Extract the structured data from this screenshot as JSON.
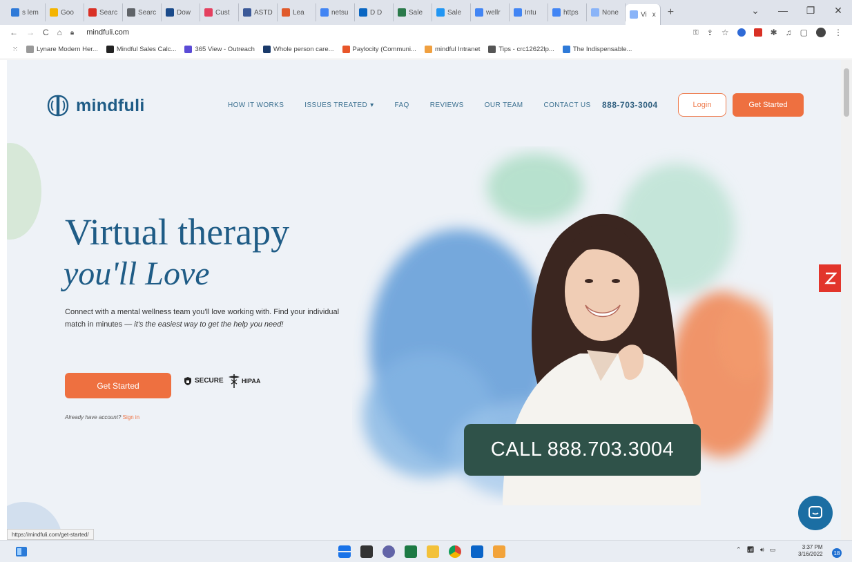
{
  "browser": {
    "tabs": [
      {
        "label": "s lem",
        "color": "#2f7ad8"
      },
      {
        "label": "Goo",
        "color": "#f4b400"
      },
      {
        "label": "Searc",
        "color": "#d93025"
      },
      {
        "label": "Searc",
        "color": "#5f6368"
      },
      {
        "label": "Dow",
        "color": "#1a4a8a"
      },
      {
        "label": "Cust",
        "color": "#e4405f"
      },
      {
        "label": "ASTD",
        "color": "#3b5998"
      },
      {
        "label": "Lea",
        "color": "#e05a2b"
      },
      {
        "label": "netsu",
        "color": "#4285f4"
      },
      {
        "label": "D D",
        "color": "#0a66c2"
      },
      {
        "label": "Sale",
        "color": "#2b7a4b"
      },
      {
        "label": "Sale",
        "color": "#2196f3"
      },
      {
        "label": "wellr",
        "color": "#4285f4"
      },
      {
        "label": "Intu",
        "color": "#4285f4"
      },
      {
        "label": "https",
        "color": "#4285f4"
      },
      {
        "label": "None",
        "color": "#8ab4f8"
      }
    ],
    "active_tab": {
      "label": "Vi",
      "close": "x"
    },
    "new_tab": "+",
    "window_controls": {
      "chevron": "⌄",
      "minimize": "—",
      "maximize": "❐",
      "close": "✕"
    },
    "url": "mindfuli.com",
    "bookmarks": [
      {
        "label": "Lynare Modern Her...",
        "color": "#999"
      },
      {
        "label": "Mindful Sales Calc...",
        "color": "#222"
      },
      {
        "label": "365 View - Outreach",
        "color": "#5b4bd6"
      },
      {
        "label": "Whole person care...",
        "color": "#1a3a6a"
      },
      {
        "label": "Paylocity (Communi...",
        "color": "#e8562a"
      },
      {
        "label": "mindful Intranet",
        "color": "#f0a040"
      },
      {
        "label": "Tips - crc12622lp...",
        "color": "#555"
      },
      {
        "label": "The Indispensable...",
        "color": "#2f7ad8"
      }
    ]
  },
  "site": {
    "brand": "mindfuli",
    "nav": [
      {
        "label": "HOW IT WORKS"
      },
      {
        "label": "ISSUES TREATED"
      },
      {
        "label": "FAQ"
      },
      {
        "label": "REVIEWS"
      },
      {
        "label": "OUR TEAM"
      },
      {
        "label": "CONTACT US"
      }
    ],
    "phone": "888-703-3004",
    "login_label": "Login",
    "get_started_label": "Get Started",
    "colors": {
      "primary": "#1f5c86",
      "accent": "#ee7040",
      "call_bg": "#2f5249"
    }
  },
  "hero": {
    "title_line1": "Virtual therapy",
    "title_line2": "you'll Love",
    "desc_plain": "Connect with a mental wellness team you'll love working with. Find your individual match in minutes — ",
    "desc_em": "it's the easiest way to get the help you need!",
    "cta_label": "Get Started",
    "secure_label": "SECURE",
    "hipaa_label": "HIPAA",
    "signin_prompt": "Already have account?",
    "signin_link": "Sign in",
    "call_text": "CALL 888.703.3004"
  },
  "status": {
    "url": "https://mindfuli.com/get-started/"
  },
  "taskbar": {
    "clock_time": "3:37 PM",
    "clock_date": "3/16/2022",
    "notifications": "18"
  }
}
